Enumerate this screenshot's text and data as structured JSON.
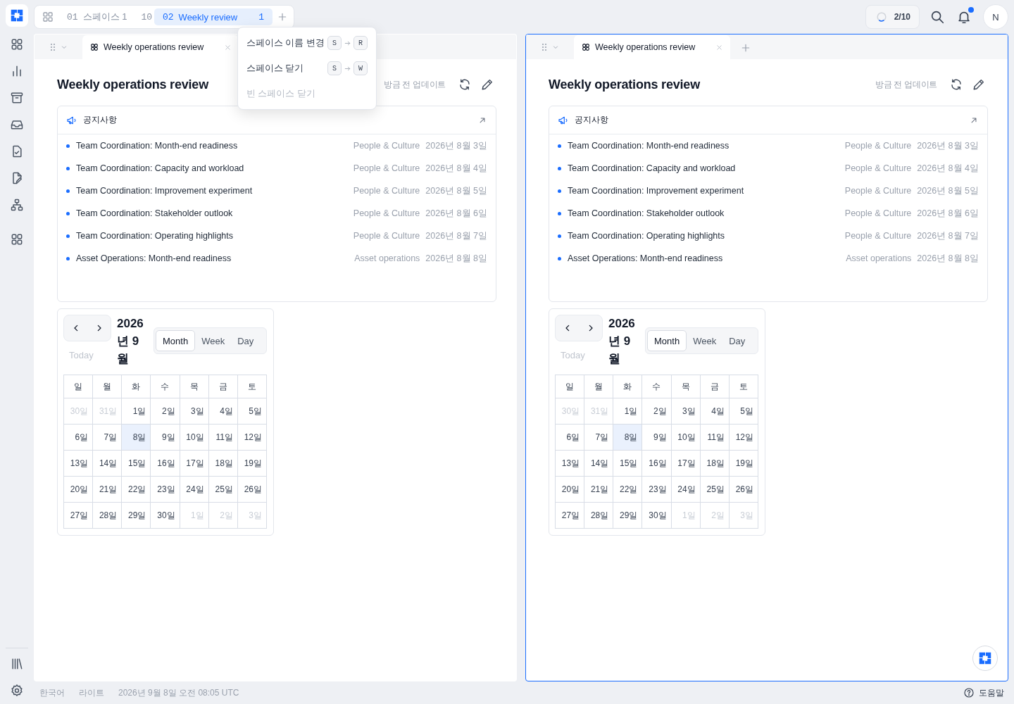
{
  "space_tabs": [
    {
      "number": "01",
      "label": "스페이스 1",
      "count": "10",
      "selected": false
    },
    {
      "number": "02",
      "label": "Weekly review",
      "count": "1",
      "selected": true
    }
  ],
  "space_menu": {
    "items": [
      {
        "label": "스페이스 이름 변경",
        "keys": [
          "S",
          "R"
        ],
        "disabled": false
      },
      {
        "label": "스페이스 닫기",
        "keys": [
          "S",
          "W"
        ],
        "disabled": false
      },
      {
        "label": "빈 스페이스 닫기",
        "disabled": true
      }
    ]
  },
  "top_bar": {
    "progress": {
      "label": "2/10",
      "level": 0.2
    },
    "notifications": {
      "unread": true
    },
    "avatar": "N"
  },
  "panes": [
    {
      "focused": false,
      "tab": {
        "label": "Weekly operations review"
      },
      "show_add_tab": false,
      "assistant_button": false,
      "title": "Weekly operations review",
      "updated": "방금 전 업데이트",
      "notices": {
        "title": "공지사항",
        "items": [
          {
            "title": "Team Coordination: Month-end readiness",
            "category": "People & Culture",
            "date": "2026년 8월 3일"
          },
          {
            "title": "Team Coordination: Capacity and workload",
            "category": "People & Culture",
            "date": "2026년 8월 4일"
          },
          {
            "title": "Team Coordination: Improvement experiment",
            "category": "People & Culture",
            "date": "2026년 8월 5일"
          },
          {
            "title": "Team Coordination: Stakeholder outlook",
            "category": "People & Culture",
            "date": "2026년 8월 6일"
          },
          {
            "title": "Team Coordination: Operating highlights",
            "category": "People & Culture",
            "date": "2026년 8월 7일"
          },
          {
            "title": "Asset Operations: Month-end readiness",
            "category": "Asset operations",
            "date": "2026년 8월 8일"
          }
        ]
      },
      "calendar": {
        "title": "2026년 9월",
        "today": "Today",
        "views": [
          {
            "label": "Month",
            "selected": true
          },
          {
            "label": "Week",
            "selected": false
          },
          {
            "label": "Day",
            "selected": false
          }
        ],
        "weekdays": [
          "일",
          "월",
          "화",
          "수",
          "목",
          "금",
          "토"
        ],
        "weeks": [
          [
            {
              "label": "30일",
              "muted": true,
              "selected": false
            },
            {
              "label": "31일",
              "muted": true,
              "selected": false
            },
            {
              "label": "1일",
              "muted": false,
              "selected": false
            },
            {
              "label": "2일",
              "muted": false,
              "selected": false
            },
            {
              "label": "3일",
              "muted": false,
              "selected": false
            },
            {
              "label": "4일",
              "muted": false,
              "selected": false
            },
            {
              "label": "5일",
              "muted": false,
              "selected": false
            }
          ],
          [
            {
              "label": "6일",
              "muted": false,
              "selected": false
            },
            {
              "label": "7일",
              "muted": false,
              "selected": false
            },
            {
              "label": "8일",
              "muted": false,
              "selected": true
            },
            {
              "label": "9일",
              "muted": false,
              "selected": false
            },
            {
              "label": "10일",
              "muted": false,
              "selected": false
            },
            {
              "label": "11일",
              "muted": false,
              "selected": false
            },
            {
              "label": "12일",
              "muted": false,
              "selected": false
            }
          ],
          [
            {
              "label": "13일",
              "muted": false,
              "selected": false
            },
            {
              "label": "14일",
              "muted": false,
              "selected": false
            },
            {
              "label": "15일",
              "muted": false,
              "selected": false
            },
            {
              "label": "16일",
              "muted": false,
              "selected": false
            },
            {
              "label": "17일",
              "muted": false,
              "selected": false
            },
            {
              "label": "18일",
              "muted": false,
              "selected": false
            },
            {
              "label": "19일",
              "muted": false,
              "selected": false
            }
          ],
          [
            {
              "label": "20일",
              "muted": false,
              "selected": false
            },
            {
              "label": "21일",
              "muted": false,
              "selected": false
            },
            {
              "label": "22일",
              "muted": false,
              "selected": false
            },
            {
              "label": "23일",
              "muted": false,
              "selected": false
            },
            {
              "label": "24일",
              "muted": false,
              "selected": false
            },
            {
              "label": "25일",
              "muted": false,
              "selected": false
            },
            {
              "label": "26일",
              "muted": false,
              "selected": false
            }
          ],
          [
            {
              "label": "27일",
              "muted": false,
              "selected": false
            },
            {
              "label": "28일",
              "muted": false,
              "selected": false
            },
            {
              "label": "29일",
              "muted": false,
              "selected": false
            },
            {
              "label": "30일",
              "muted": false,
              "selected": false
            },
            {
              "label": "1일",
              "muted": true,
              "selected": false
            },
            {
              "label": "2일",
              "muted": true,
              "selected": false
            },
            {
              "label": "3일",
              "muted": true,
              "selected": false
            }
          ]
        ]
      }
    },
    {
      "focused": true,
      "tab": {
        "label": "Weekly operations review"
      },
      "show_add_tab": true,
      "assistant_button": true,
      "title": "Weekly operations review",
      "updated": "방금 전 업데이트",
      "notices": {
        "title": "공지사항",
        "items": [
          {
            "title": "Team Coordination: Month-end readiness",
            "category": "People & Culture",
            "date": "2026년 8월 3일"
          },
          {
            "title": "Team Coordination: Capacity and workload",
            "category": "People & Culture",
            "date": "2026년 8월 4일"
          },
          {
            "title": "Team Coordination: Improvement experiment",
            "category": "People & Culture",
            "date": "2026년 8월 5일"
          },
          {
            "title": "Team Coordination: Stakeholder outlook",
            "category": "People & Culture",
            "date": "2026년 8월 6일"
          },
          {
            "title": "Team Coordination: Operating highlights",
            "category": "People & Culture",
            "date": "2026년 8월 7일"
          },
          {
            "title": "Asset Operations: Month-end readiness",
            "category": "Asset operations",
            "date": "2026년 8월 8일"
          }
        ]
      },
      "calendar": {
        "title": "2026년 9월",
        "today": "Today",
        "views": [
          {
            "label": "Month",
            "selected": true
          },
          {
            "label": "Week",
            "selected": false
          },
          {
            "label": "Day",
            "selected": false
          }
        ],
        "weekdays": [
          "일",
          "월",
          "화",
          "수",
          "목",
          "금",
          "토"
        ],
        "weeks": [
          [
            {
              "label": "30일",
              "muted": true,
              "selected": false
            },
            {
              "label": "31일",
              "muted": true,
              "selected": false
            },
            {
              "label": "1일",
              "muted": false,
              "selected": false
            },
            {
              "label": "2일",
              "muted": false,
              "selected": false
            },
            {
              "label": "3일",
              "muted": false,
              "selected": false
            },
            {
              "label": "4일",
              "muted": false,
              "selected": false
            },
            {
              "label": "5일",
              "muted": false,
              "selected": false
            }
          ],
          [
            {
              "label": "6일",
              "muted": false,
              "selected": false
            },
            {
              "label": "7일",
              "muted": false,
              "selected": false
            },
            {
              "label": "8일",
              "muted": false,
              "selected": true
            },
            {
              "label": "9일",
              "muted": false,
              "selected": false
            },
            {
              "label": "10일",
              "muted": false,
              "selected": false
            },
            {
              "label": "11일",
              "muted": false,
              "selected": false
            },
            {
              "label": "12일",
              "muted": false,
              "selected": false
            }
          ],
          [
            {
              "label": "13일",
              "muted": false,
              "selected": false
            },
            {
              "label": "14일",
              "muted": false,
              "selected": false
            },
            {
              "label": "15일",
              "muted": false,
              "selected": false
            },
            {
              "label": "16일",
              "muted": false,
              "selected": false
            },
            {
              "label": "17일",
              "muted": false,
              "selected": false
            },
            {
              "label": "18일",
              "muted": false,
              "selected": false
            },
            {
              "label": "19일",
              "muted": false,
              "selected": false
            }
          ],
          [
            {
              "label": "20일",
              "muted": false,
              "selected": false
            },
            {
              "label": "21일",
              "muted": false,
              "selected": false
            },
            {
              "label": "22일",
              "muted": false,
              "selected": false
            },
            {
              "label": "23일",
              "muted": false,
              "selected": false
            },
            {
              "label": "24일",
              "muted": false,
              "selected": false
            },
            {
              "label": "25일",
              "muted": false,
              "selected": false
            },
            {
              "label": "26일",
              "muted": false,
              "selected": false
            }
          ],
          [
            {
              "label": "27일",
              "muted": false,
              "selected": false
            },
            {
              "label": "28일",
              "muted": false,
              "selected": false
            },
            {
              "label": "29일",
              "muted": false,
              "selected": false
            },
            {
              "label": "30일",
              "muted": false,
              "selected": false
            },
            {
              "label": "1일",
              "muted": true,
              "selected": false
            },
            {
              "label": "2일",
              "muted": true,
              "selected": false
            },
            {
              "label": "3일",
              "muted": true,
              "selected": false
            }
          ]
        ]
      }
    }
  ],
  "footer": {
    "language": "한국어",
    "theme": "라이트",
    "datetime": "2026년 9월 8일 오전 08:05 UTC",
    "help": "도움말"
  }
}
